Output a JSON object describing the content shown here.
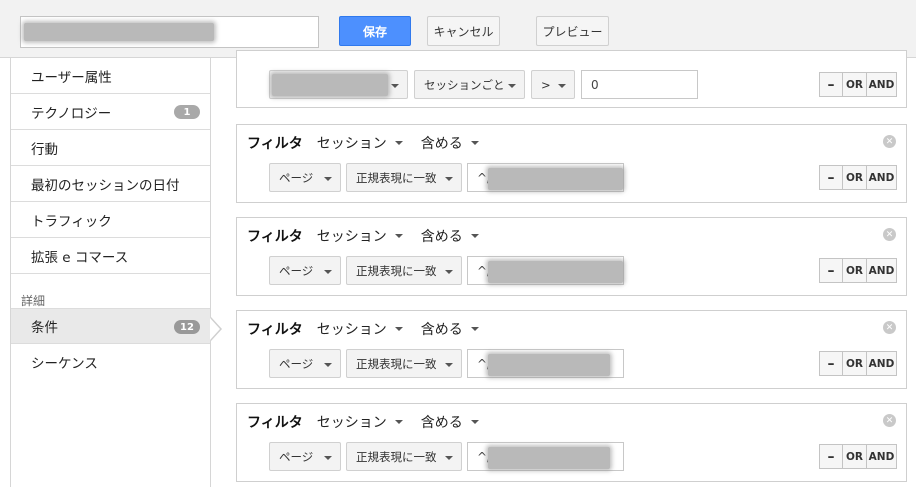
{
  "toolbar": {
    "save_label": "保存",
    "cancel_label": "キャンセル",
    "preview_label": "プレビュー"
  },
  "sidebar": {
    "items": [
      {
        "label": "ユーザー属性",
        "badge": ""
      },
      {
        "label": "テクノロジー",
        "badge": "1"
      },
      {
        "label": "行動",
        "badge": ""
      },
      {
        "label": "最初のセッションの日付",
        "badge": ""
      },
      {
        "label": "トラフィック",
        "badge": ""
      },
      {
        "label": "拡張 e コマース",
        "badge": ""
      }
    ],
    "section_label": "詳細",
    "advanced_items": [
      {
        "label": "条件",
        "badge": "12",
        "active": true
      },
      {
        "label": "シーケンス",
        "badge": ""
      }
    ]
  },
  "top_condition": {
    "scope": "セッションごと",
    "operator": ">",
    "value": "0",
    "minus": "–",
    "or": "OR",
    "and": "AND"
  },
  "filters": [
    {
      "title": "フィルタ",
      "scope": "セッション",
      "mode": "含める",
      "dimension": "ページ",
      "match": "正規表現に一致",
      "value": "^/",
      "minus": "–",
      "or": "OR",
      "and": "AND"
    },
    {
      "title": "フィルタ",
      "scope": "セッション",
      "mode": "含める",
      "dimension": "ページ",
      "match": "正規表現に一致",
      "value": "^/",
      "minus": "–",
      "or": "OR",
      "and": "AND"
    },
    {
      "title": "フィルタ",
      "scope": "セッション",
      "mode": "含める",
      "dimension": "ページ",
      "match": "正規表現に一致",
      "value": "^/",
      "minus": "–",
      "or": "OR",
      "and": "AND"
    },
    {
      "title": "フィルタ",
      "scope": "セッション",
      "mode": "含める",
      "dimension": "ページ",
      "match": "正規表現に一致",
      "value": "^/",
      "minus": "–",
      "or": "OR",
      "and": "AND"
    }
  ],
  "icons": {
    "close": "close-circle-icon",
    "caret": "chevron-down-icon"
  },
  "colors": {
    "primary_button": "#4d90fe",
    "badge": "#a9a9a9"
  }
}
